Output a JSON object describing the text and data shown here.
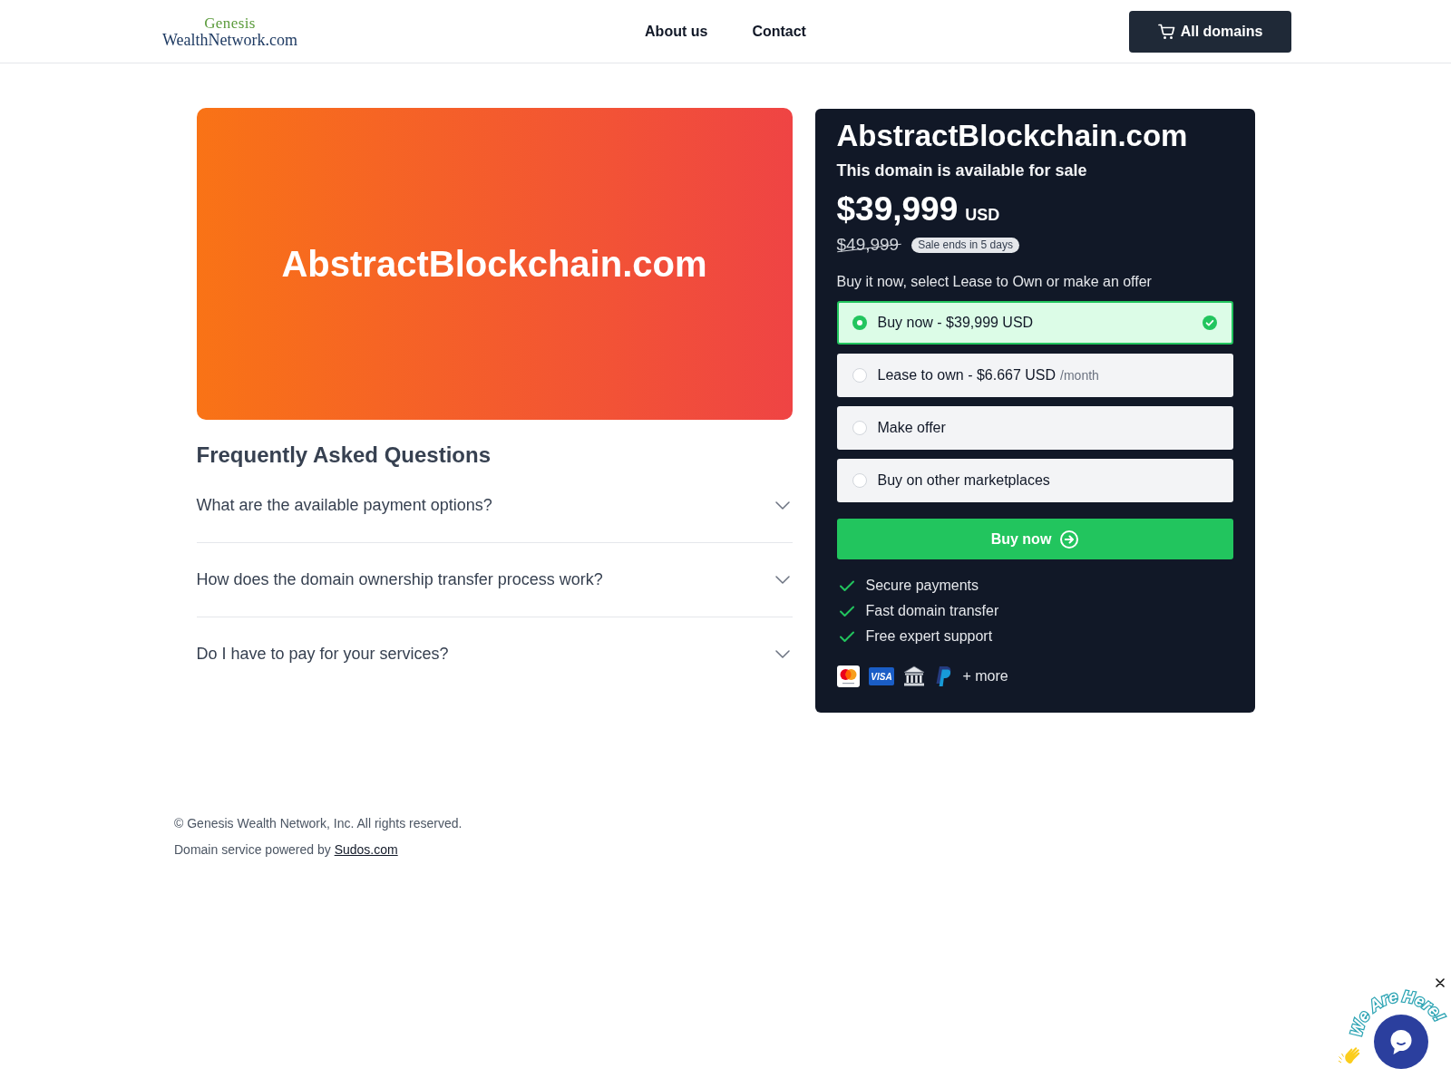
{
  "header": {
    "logo": {
      "line_1": "Genesis",
      "line_2": "WealthNetwork.com"
    },
    "nav": [
      {
        "label": "About us"
      },
      {
        "label": "Contact"
      }
    ],
    "cta": {
      "label": "All domains"
    }
  },
  "hero": {
    "domain": "AbstractBlockchain.com"
  },
  "faq": {
    "title": "Frequently Asked Questions",
    "items": [
      {
        "question": "What are the available payment options?",
        "expanded": false
      },
      {
        "question": "How does the domain ownership transfer process work?",
        "expanded": false
      },
      {
        "question": "Do I have to pay for your services?",
        "expanded": false
      }
    ]
  },
  "offer": {
    "domain": "AbstractBlockchain.com",
    "subtitle": "This domain is available for sale",
    "price": "$39,999",
    "currency": "USD",
    "old_price": "$49,999",
    "badge": "Sale ends in 5 days",
    "prompt": "Buy it now, select Lease to Own or make an offer",
    "options": [
      {
        "label": "Buy now - $39,999 USD",
        "selected": true
      },
      {
        "label": "Lease to own - $6.667 USD",
        "suffix": "/month",
        "selected": false
      },
      {
        "label": "Make offer",
        "selected": false
      },
      {
        "label": "Buy on other marketplaces",
        "selected": false
      }
    ],
    "button": {
      "label": "Buy now"
    },
    "features": [
      "Secure payments",
      "Fast domain transfer",
      "Free expert support"
    ],
    "payment_methods": [
      {
        "kind": "mastercard"
      },
      {
        "kind": "visa",
        "label": "VISA"
      },
      {
        "kind": "bank"
      },
      {
        "kind": "paypal"
      }
    ],
    "more": "+ more"
  },
  "footer": {
    "copyright": "© Genesis Wealth Network, Inc. All rights reserved.",
    "powered_by": "Domain service powered by",
    "link": "Sudos.com"
  },
  "chat_widget": {
    "greeting_words": [
      "We",
      "Are",
      "Here!"
    ]
  }
}
